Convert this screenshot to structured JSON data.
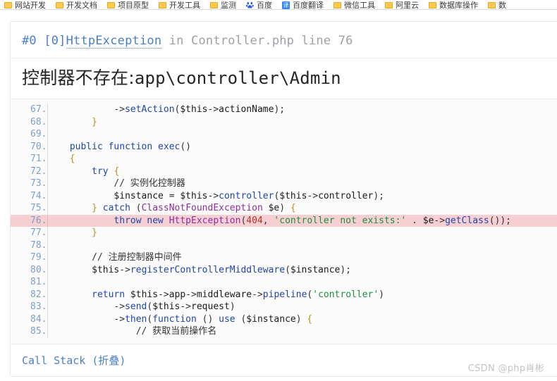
{
  "browser": {
    "bookmarks": [
      {
        "label": "网站开发",
        "icon": "folder-icon"
      },
      {
        "label": "开发文档",
        "icon": "folder-icon"
      },
      {
        "label": "项目原型",
        "icon": "folder-icon"
      },
      {
        "label": "开发工具",
        "icon": "folder-icon"
      },
      {
        "label": "监测",
        "icon": "folder-icon"
      },
      {
        "label": "百度",
        "icon": "baidu-icon"
      },
      {
        "label": "百度翻译",
        "icon": "baidu-fanyi-icon",
        "icon_char": "译"
      },
      {
        "label": "微信工具",
        "icon": "folder-icon"
      },
      {
        "label": "阿里云",
        "icon": "folder-icon"
      },
      {
        "label": "数据库操作",
        "icon": "folder-icon"
      },
      {
        "label": "数",
        "icon": "folder-icon"
      }
    ]
  },
  "exception": {
    "frame_index": "#0",
    "code_marker": "[0]",
    "class_name": "HttpException",
    "in_word": "in",
    "file": "Controller.php",
    "line_word": "line",
    "line_number": "76",
    "message_prefix": "控制器不存在:",
    "message_value": "app\\controller\\Admin",
    "highlight_line": 76
  },
  "code": {
    "lines": [
      {
        "no": "67.",
        "text": "            ->setAction($this->actionName);"
      },
      {
        "no": "68.",
        "text": "        }"
      },
      {
        "no": "69.",
        "text": ""
      },
      {
        "no": "70.",
        "text": "    public function exec()"
      },
      {
        "no": "71.",
        "text": "    {"
      },
      {
        "no": "72.",
        "text": "        try {"
      },
      {
        "no": "73.",
        "text": "            // 实例化控制器"
      },
      {
        "no": "74.",
        "text": "            $instance = $this->controller($this->controller);"
      },
      {
        "no": "75.",
        "text": "        } catch (ClassNotFoundException $e) {"
      },
      {
        "no": "76.",
        "text": "            throw new HttpException(404, 'controller not exists:' . $e->getClass());"
      },
      {
        "no": "77.",
        "text": "        }"
      },
      {
        "no": "78.",
        "text": ""
      },
      {
        "no": "79.",
        "text": "        // 注册控制器中间件"
      },
      {
        "no": "80.",
        "text": "        $this->registerControllerMiddleware($instance);"
      },
      {
        "no": "81.",
        "text": ""
      },
      {
        "no": "82.",
        "text": "        return $this->app->middleware->pipeline('controller')"
      },
      {
        "no": "83.",
        "text": "            ->send($this->request)"
      },
      {
        "no": "84.",
        "text": "            ->then(function () use ($instance) {"
      },
      {
        "no": "85.",
        "text": "                // 获取当前操作名"
      }
    ]
  },
  "footer": {
    "call_stack_label": "Call Stack (折叠)",
    "watermark": "CSDN @php肖彬"
  },
  "colors": {
    "link": "#4b7fc4",
    "highlight_row": "#f6cfd2",
    "folder_icon": "#ffc94d",
    "baidu_blue": "#3388ff"
  }
}
